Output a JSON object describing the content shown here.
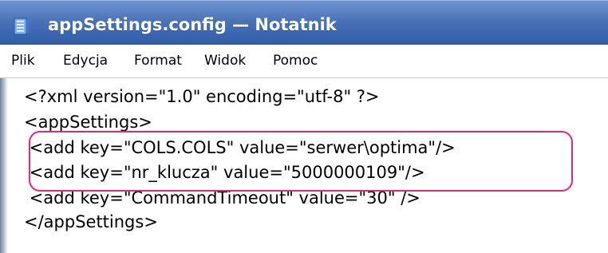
{
  "window": {
    "title": "appSettings.config — Notatnik"
  },
  "menu": {
    "items": [
      {
        "label": "Plik"
      },
      {
        "label": "Edycja"
      },
      {
        "label": "Format"
      },
      {
        "label": "Widok"
      },
      {
        "label": "Pomoc"
      }
    ]
  },
  "editor": {
    "lines": [
      "<?xml version=\"1.0\" encoding=\"utf-8\" ?>",
      "<appSettings>",
      " <add key=\"COLS.COLS\" value=\"serwer\\optima\"/>",
      " <add key=\"nr_klucza\" value=\"5000000109\"/>",
      " <add key=\"CommandTimeout\" value=\"30\" />",
      "</appSettings>"
    ]
  },
  "icons": {
    "app_icon": "notepad-icon"
  },
  "colors": {
    "titlebar": "#2f5ca9",
    "highlight": "#e0287a"
  }
}
